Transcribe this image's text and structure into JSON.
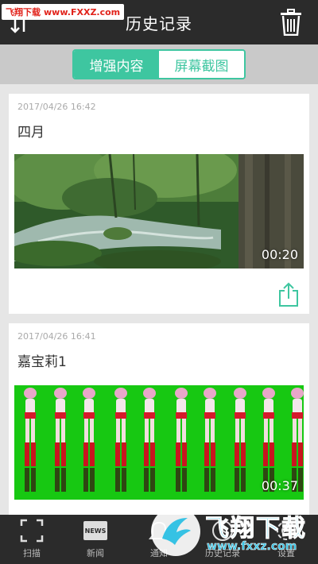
{
  "header": {
    "title": "历史记录",
    "watermark_site": "飞翔下载",
    "watermark_url": "www.FXXZ.com"
  },
  "segments": {
    "active": "增强内容",
    "inactive": "屏幕截图"
  },
  "records": [
    {
      "date": "2017/04/26 16:42",
      "name": "四月",
      "duration": "00:20"
    },
    {
      "date": "2017/04/26 16:41",
      "name": "嘉宝莉1",
      "duration": "00:37"
    }
  ],
  "tabs": [
    {
      "label": "扫描",
      "icon": "scan-icon"
    },
    {
      "label": "新闻",
      "icon": "news-icon",
      "icon_text": "NEWS"
    },
    {
      "label": "通知",
      "icon": "notify-icon"
    },
    {
      "label": "历史记录",
      "icon": "history-icon"
    },
    {
      "label": "设置",
      "icon": "settings-icon"
    }
  ],
  "watermark": {
    "brand": "飞翔下载",
    "url": "www.fxxz.com"
  },
  "colors": {
    "accent": "#3ec6a0",
    "bar": "#2b2b2b",
    "watermark": "#36c2e4"
  }
}
